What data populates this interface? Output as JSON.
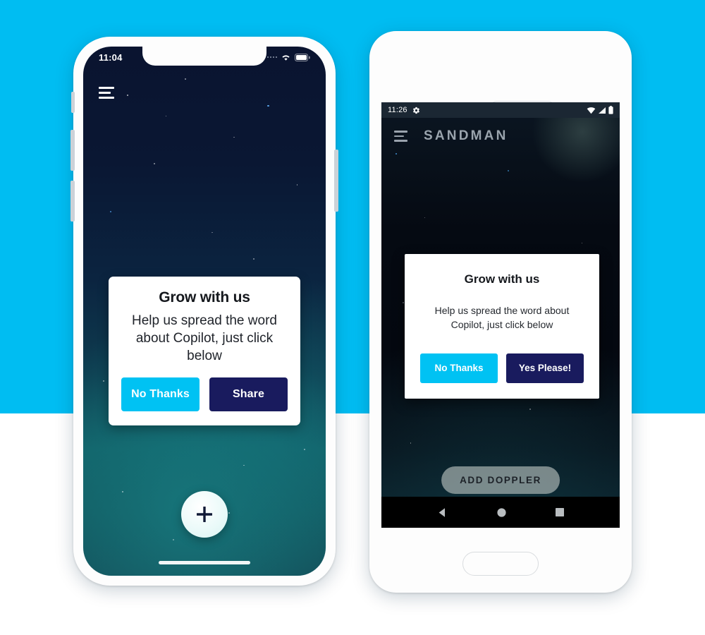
{
  "page": {
    "background_top_color": "#00bdf2",
    "background_bottom_color": "#ffffff"
  },
  "theme": {
    "cyan": "#00c2f3",
    "navy": "#191b5e",
    "dialog_bg": "#ffffff",
    "title_color": "#15181d"
  },
  "iphone": {
    "device": "iphone-x",
    "status_bar": {
      "time": "11:04",
      "icons": [
        "cellular-dots-icon",
        "wifi-icon",
        "battery-icon"
      ]
    },
    "app_bar": {
      "menu_icon": "hamburger-menu-icon"
    },
    "dialog": {
      "title": "Grow with us",
      "body": "Help us spread the word about Copilot, just click below",
      "buttons": [
        {
          "label": "No Thanks",
          "color": "#00c2f3"
        },
        {
          "label": "Share",
          "color": "#191b5e"
        }
      ]
    },
    "fab": {
      "icon": "plus-icon",
      "label": "+"
    },
    "home_indicator": true
  },
  "android": {
    "device": "android-phone",
    "status_bar": {
      "time": "11:26",
      "left_icons": [
        "gear-icon"
      ],
      "right_icons": [
        "wifi-icon",
        "signal-icon",
        "battery-icon"
      ]
    },
    "app_bar": {
      "menu_icon": "hamburger-menu-icon",
      "title": "SANDMAN"
    },
    "dialog": {
      "title": "Grow with us",
      "body": "Help us spread the word about Copilot, just click below",
      "buttons": [
        {
          "label": "No Thanks",
          "color": "#00c2f3"
        },
        {
          "label": "Yes Please!",
          "color": "#191b5e"
        }
      ]
    },
    "cta_button": {
      "label": "ADD DOPPLER"
    },
    "nav_bar": {
      "back_icon": "back-triangle-icon",
      "home_icon": "home-circle-icon",
      "recents_icon": "recents-square-icon"
    }
  }
}
